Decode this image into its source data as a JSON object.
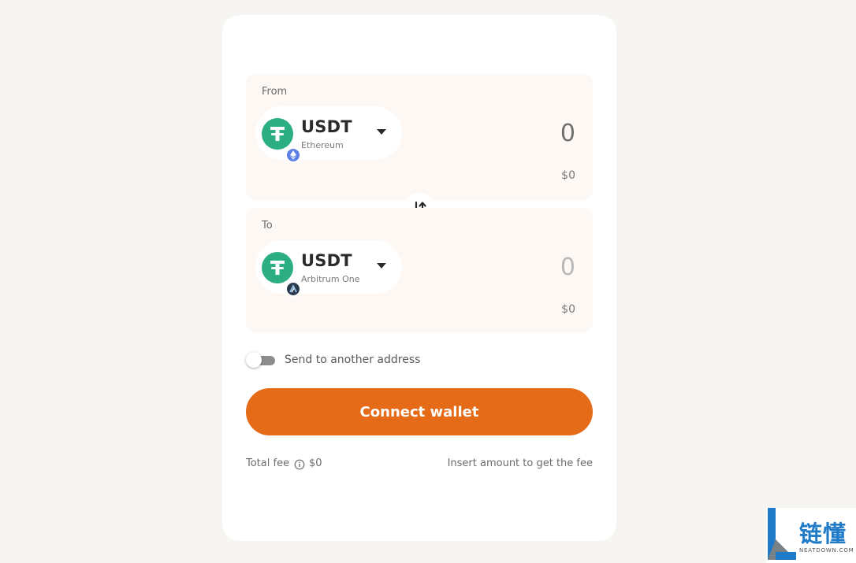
{
  "from": {
    "label": "From",
    "token": {
      "symbol": "USDT",
      "chain": "Ethereum",
      "logo_icon": "usdt-icon",
      "chain_icon": "ethereum-icon"
    },
    "amount": "0",
    "usd_value": "$0"
  },
  "to": {
    "label": "To",
    "token": {
      "symbol": "USDT",
      "chain": "Arbitrum One",
      "logo_icon": "usdt-icon",
      "chain_icon": "arbitrum-icon"
    },
    "amount": "0",
    "usd_value": "$0"
  },
  "swap_icon": "swap-arrows-icon",
  "send_toggle": {
    "label": "Send to another address",
    "enabled": false
  },
  "connect_button": {
    "label": "Connect wallet"
  },
  "fee": {
    "label": "Total fee",
    "value": "$0",
    "hint": "Insert amount to get the fee"
  },
  "watermark": {
    "cn_text": "链懂",
    "en_text": "NEATDOWN.COM"
  },
  "colors": {
    "accent": "#e66b18",
    "page_background": "#f6f5f2",
    "panel_background": "#fdf8f4",
    "usdt_green": "#2dae82",
    "ethereum_badge": "#5d7fe6",
    "arbitrum_badge": "#2b3b4f",
    "watermark_blue": "#1f7ac8"
  }
}
